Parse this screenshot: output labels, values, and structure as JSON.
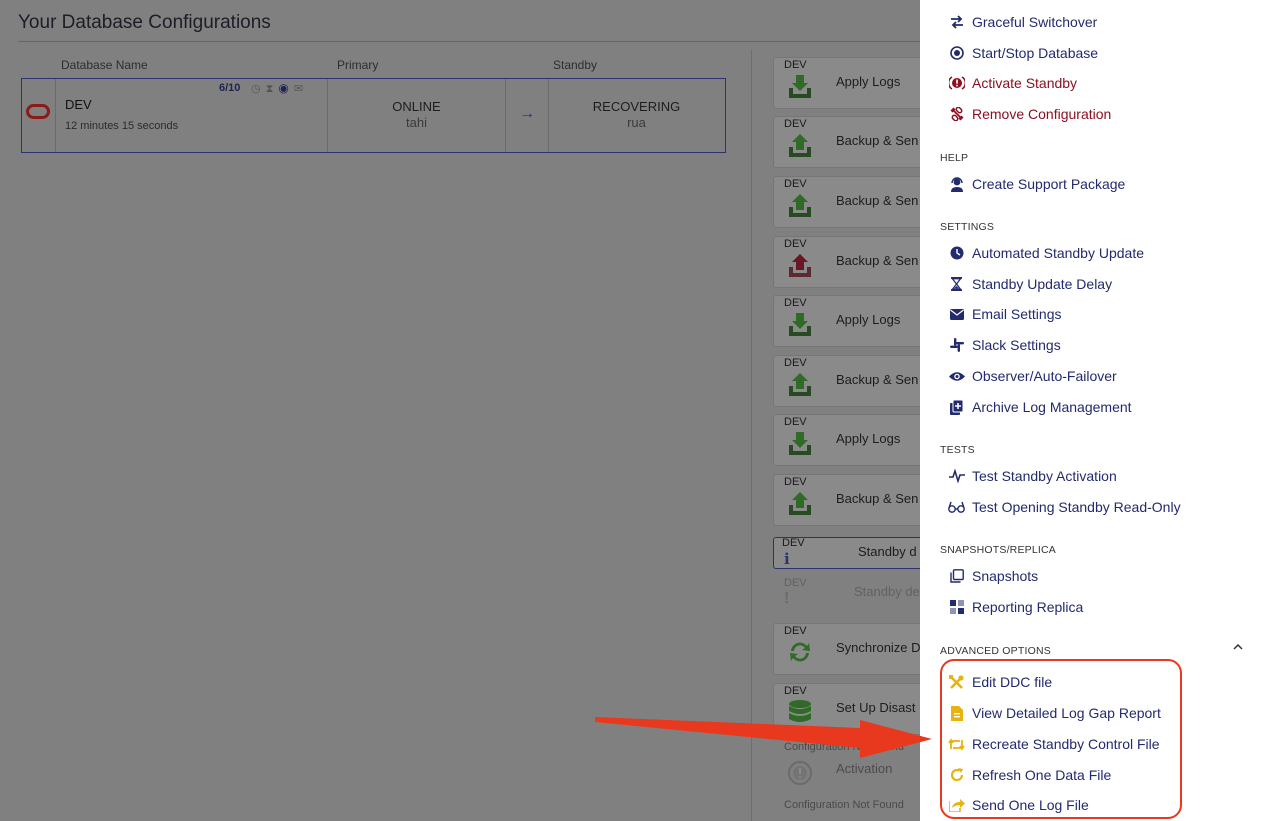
{
  "page": {
    "title": "Your Database Configurations"
  },
  "table": {
    "headers": [
      "Database Name",
      "Primary",
      "Standby"
    ],
    "row": {
      "name": "DEV",
      "elapsed": "12 minutes 15 seconds",
      "score": "6/10",
      "primary_status": "ONLINE",
      "primary_host": "tahi",
      "standby_status": "RECOVERING",
      "standby_host": "rua"
    }
  },
  "tasks": [
    {
      "tag": "DEV",
      "label": "Apply Logs",
      "icon": "download-green-icon"
    },
    {
      "tag": "DEV",
      "label": "Backup & Sen",
      "icon": "upload-green-icon"
    },
    {
      "tag": "DEV",
      "label": "Backup & Sen",
      "icon": "upload-green-icon"
    },
    {
      "tag": "DEV",
      "label": "Backup & Sen",
      "icon": "upload-red-icon"
    },
    {
      "tag": "DEV",
      "label": "Apply Logs",
      "icon": "download-green-icon"
    },
    {
      "tag": "DEV",
      "label": "Backup & Sen",
      "icon": "upload-green-icon"
    },
    {
      "tag": "DEV",
      "label": "Apply Logs",
      "icon": "download-green-icon"
    },
    {
      "tag": "DEV",
      "label": "Backup & Sen",
      "icon": "upload-green-icon"
    },
    {
      "tag": "DEV",
      "label": "Standby d",
      "icon": "info-icon"
    },
    {
      "tag": "DEV",
      "label": "Standby de",
      "icon": "exclamation-icon"
    },
    {
      "tag": "DEV",
      "label": "Synchronize D",
      "icon": "sync-icon"
    },
    {
      "tag": "DEV",
      "label": "Set Up Disast",
      "icon": "database-icon"
    },
    {
      "tag": "Configuration Not Found",
      "label": "Activation",
      "icon": "alert-circle-icon"
    },
    {
      "tag": "Configuration Not Found",
      "label": "",
      "icon": ""
    }
  ],
  "menu": {
    "top_items": [
      {
        "label": "Graceful Switchover",
        "icon": "switch-arrows-icon",
        "danger": false
      },
      {
        "label": "Start/Stop Database",
        "icon": "stop-circle-icon",
        "danger": false
      },
      {
        "label": "Activate Standby",
        "icon": "alert-badge-icon",
        "danger": true
      },
      {
        "label": "Remove Configuration",
        "icon": "unlink-icon",
        "danger": true
      }
    ],
    "help": {
      "heading": "HELP",
      "items": [
        {
          "label": "Create Support Package",
          "icon": "support-agent-icon"
        }
      ]
    },
    "settings": {
      "heading": "SETTINGS",
      "items": [
        {
          "label": "Automated Standby Update",
          "icon": "clock-icon"
        },
        {
          "label": "Standby Update Delay",
          "icon": "hourglass-icon"
        },
        {
          "label": "Email Settings",
          "icon": "envelope-icon"
        },
        {
          "label": "Slack Settings",
          "icon": "slack-icon"
        },
        {
          "label": "Observer/Auto-Failover",
          "icon": "eye-icon"
        },
        {
          "label": "Archive Log Management",
          "icon": "archive-icon"
        }
      ]
    },
    "tests": {
      "heading": "TESTS",
      "items": [
        {
          "label": "Test Standby Activation",
          "icon": "pulse-icon"
        },
        {
          "label": "Test Opening Standby Read-Only",
          "icon": "glasses-icon"
        }
      ]
    },
    "snapshots": {
      "heading": "SNAPSHOTS/REPLICA",
      "items": [
        {
          "label": "Snapshots",
          "icon": "copy-icon"
        },
        {
          "label": "Reporting Replica",
          "icon": "grid-icon"
        }
      ]
    },
    "advanced": {
      "heading": "ADVANCED OPTIONS",
      "items": [
        {
          "label": "Edit DDC file",
          "icon": "tools-icon"
        },
        {
          "label": "View Detailed Log Gap Report",
          "icon": "file-report-icon"
        },
        {
          "label": "Recreate Standby Control File",
          "icon": "retweet-icon"
        },
        {
          "label": "Refresh One Data File",
          "icon": "refresh-icon"
        },
        {
          "label": "Send One Log File",
          "icon": "share-file-icon"
        }
      ]
    }
  },
  "colors": {
    "accent": "#232a6e",
    "danger": "#8c1020",
    "advanced_icon": "#e8b20f",
    "highlight": "#e8391f"
  }
}
